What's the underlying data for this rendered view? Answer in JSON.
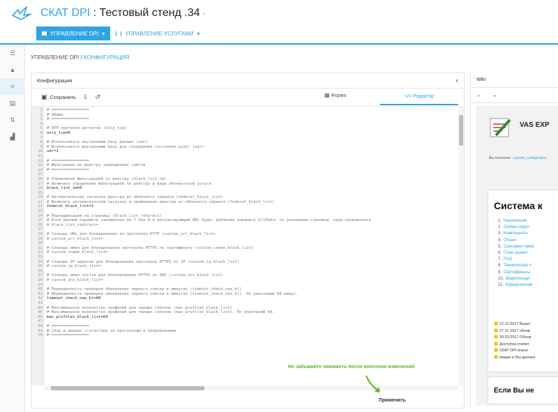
{
  "app": {
    "brand": "СКАТ DPI",
    "title_rest": " : Тестовый стенд .34",
    "caret": "-"
  },
  "nav": {
    "dpi_label": "УПРАВЛЕНИЕ DPI",
    "services_label": "УПРАВЛЕНИЕ УСЛУГАМИ",
    "caret": "▾"
  },
  "breadcrumb": {
    "root": "УПРАВЛЕНИЕ DPI",
    "sep": " / ",
    "current": "КОНФИГУРАЦИЯ"
  },
  "config": {
    "title": "Конфигурация",
    "collapse": "‹",
    "save_label": "Сохранить",
    "tab_form": "Форма",
    "tab_editor": "</> Редактор",
    "hint": "Не забывайте нажимать после внесения изменений",
    "apply_label": "Применить",
    "lines": [
      {
        "n": "1",
        "text": "# ================",
        "cls": "c"
      },
      {
        "n": "2",
        "text": "# Общие",
        "cls": "c"
      },
      {
        "n": "3",
        "text": "# ================",
        "cls": "c"
      },
      {
        "n": "4",
        "text": "",
        "cls": "c"
      },
      {
        "n": "5",
        "text": "# DPP протокол детектор (only_tcp)",
        "cls": "c"
      },
      {
        "n": "6",
        "text": "only_tcp=0",
        "cls": "k"
      },
      {
        "n": "7",
        "text": "",
        "cls": "c"
      },
      {
        "n": "8",
        "text": "# Использовать внутреннюю базу данных (udr)",
        "cls": "c"
      },
      {
        "n": "9",
        "text": "# Использовать внутреннюю базу для сохранения состояния услуг (udr)",
        "cls": "c"
      },
      {
        "n": "10",
        "text": "udr=1",
        "cls": "k"
      },
      {
        "n": "11",
        "text": "",
        "cls": "c"
      },
      {
        "n": "12",
        "text": "# ================",
        "cls": "c"
      },
      {
        "n": "13",
        "text": "# Фильтрация по реестру запрещенных сайтов",
        "cls": "c"
      },
      {
        "n": "14",
        "text": "# ================",
        "cls": "c"
      },
      {
        "n": "15",
        "text": "",
        "cls": "c"
      },
      {
        "n": "16",
        "text": "# Управление фильтрацией по реестру (black_list_sm)",
        "cls": "c"
      },
      {
        "n": "17",
        "text": "# Включить управление фильтрацией по реестру в виде абонентской услуги",
        "cls": "c"
      },
      {
        "n": "18",
        "text": "black_list_sm=0",
        "cls": "k"
      },
      {
        "n": "19",
        "text": "",
        "cls": "c"
      },
      {
        "n": "20",
        "text": "# Автоматическая загрузка реестра из облачного сервиса (federal_black_list)",
        "cls": "c"
      },
      {
        "n": "21",
        "text": "# Включить автоматическую загрузку и применение реестра из облачного сервиса (federal_black_list)",
        "cls": "c"
      },
      {
        "n": "22",
        "text": "federal_black_list=1",
        "cls": "k"
      },
      {
        "n": "23",
        "text": "",
        "cls": "c"
      },
      {
        "n": "24",
        "text": "# Переадресация на страницу (black_list_redirect)",
        "cls": "c"
      },
      {
        "n": "25",
        "text": "# Если данный параметр закоменчен на 7 или 8 в результирующий URL будет добавлен параметр UrlRedir со указанием страницы, куда направлялся",
        "cls": "c"
      },
      {
        "n": "26",
        "text": "# black_list_redirect=",
        "cls": "c"
      },
      {
        "n": "27",
        "text": "",
        "cls": "c"
      },
      {
        "n": "28",
        "text": "# Словарь URL для блокирования по протоколу HTTP (custom_url_black_list)",
        "cls": "c"
      },
      {
        "n": "29",
        "text": "# custom_url_black_list=",
        "cls": "c"
      },
      {
        "n": "30",
        "text": "",
        "cls": "c"
      },
      {
        "n": "31",
        "text": "# Словарь имен для блокирования протокола HTTPS по сертификату (custom_cname_black_list)",
        "cls": "c"
      },
      {
        "n": "32",
        "text": "# custom_cname_black_list=",
        "cls": "c"
      },
      {
        "n": "33",
        "text": "",
        "cls": "c"
      },
      {
        "n": "34",
        "text": "# Словарь IP адресов для блокирования протокола HTTPS по IP (custom_ip_black_list)",
        "cls": "c"
      },
      {
        "n": "35",
        "text": "# custom_ip_black_list=",
        "cls": "c"
      },
      {
        "n": "36",
        "text": "",
        "cls": "c"
      },
      {
        "n": "37",
        "text": "# Словарь имен хостов для блокирования HTTPS по SNI (custom_sni_black_list)",
        "cls": "c"
      },
      {
        "n": "38",
        "text": "# custom_sni_black_list=",
        "cls": "c"
      },
      {
        "n": "39",
        "text": "",
        "cls": "c"
      },
      {
        "n": "40",
        "text": "# Периодичность проверки обновления черного списка в минутах (timeout_check_new_bl)",
        "cls": "c"
      },
      {
        "n": "41",
        "text": "# Периодичность проверки обновления черного списка в минутах (timeout_check_new_bl). По умолчанию 60 минут.",
        "cls": "c"
      },
      {
        "n": "42",
        "text": "timeout_check_new_bl=60",
        "cls": "k"
      },
      {
        "n": "43",
        "text": "",
        "cls": "c"
      },
      {
        "n": "44",
        "text": "# Максимальное количество профилей для черных списков (max_profiles_black_list)",
        "cls": "c"
      },
      {
        "n": "45",
        "text": "# Максимальное количество профилей для черных списков (max_profiles_black_list). По умолчанию 64.",
        "cls": "c"
      },
      {
        "n": "46",
        "text": "max_profiles_black_list=64",
        "cls": "k"
      },
      {
        "n": "47",
        "text": "",
        "cls": "c"
      },
      {
        "n": "48",
        "text": "# ================",
        "cls": "c"
      },
      {
        "n": "49",
        "text": "# Сбор и анализ статистики по протоколам и направлениям",
        "cls": "c"
      },
      {
        "n": "50",
        "text": "# ================",
        "cls": "c"
      }
    ]
  },
  "wiki": {
    "title": "Wiki",
    "back": "←",
    "forward": "→",
    "logo_text": "VAS EXP",
    "crumb_prefix": "Вы посетили: ",
    "crumb_link": "» priority_configuration",
    "heading": "Система к",
    "toc": [
      {
        "n": "1.",
        "t": "Назначение"
      },
      {
        "n": "2.",
        "t": "Схемы подкл"
      },
      {
        "n": "3.",
        "t": "Компоненты"
      },
      {
        "n": "4.",
        "t": "Опции"
      },
      {
        "n": "5.",
        "t": "Сценарии прим"
      },
      {
        "n": "6.",
        "t": "План развит"
      },
      {
        "n": "7.",
        "t": "FAQ"
      },
      {
        "n": "8.",
        "t": "Техническая п"
      },
      {
        "n": "9.",
        "t": "Сертификаты"
      },
      {
        "n": "10.",
        "t": "Видеосоеди"
      },
      {
        "n": "11.",
        "t": "Юридическая"
      }
    ],
    "news": [
      "12.12.2017 Вышл",
      "27.11.2017 обнов",
      "20.03.2017 Обнов",
      "Доступна утилит",
      "СКАТ DPI внесе",
      "мации и баз данных"
    ],
    "footer_heading": "Если Вы не"
  }
}
